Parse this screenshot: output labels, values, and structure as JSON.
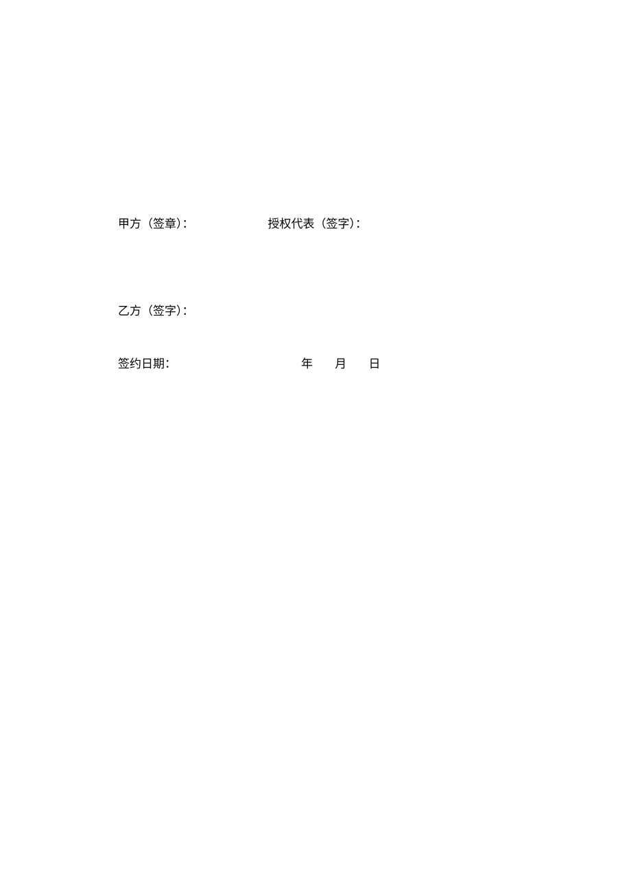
{
  "signature": {
    "partyA": "甲方（签章）：",
    "authorizedRep": "授权代表（签字）：",
    "partyB": "乙方（签字）：",
    "dateLabel": "签约日期：",
    "year": "年",
    "month": "月",
    "day": "日"
  }
}
